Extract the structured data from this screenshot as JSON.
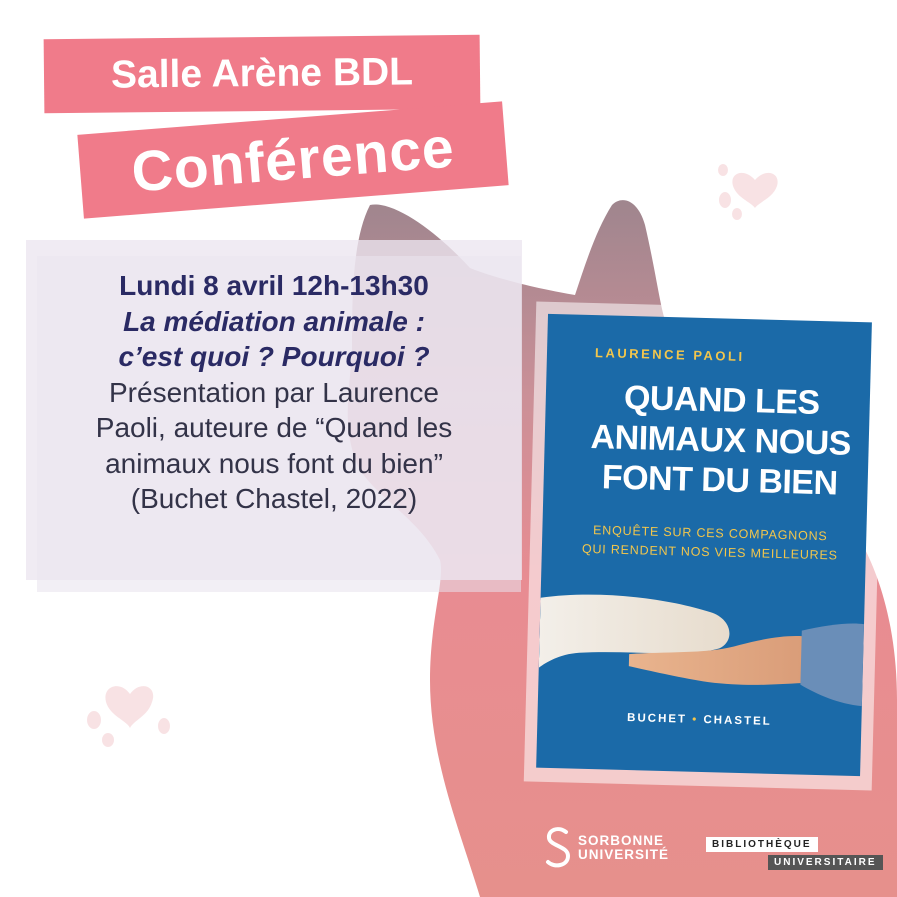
{
  "header": {
    "venue": "Salle Arène BDL",
    "event_type": "Conférence"
  },
  "event": {
    "date_time": "Lundi 8 avril 12h-13h30",
    "title_line1": "La médiation animale :",
    "title_line2": "c’est quoi ? Pourquoi ?",
    "desc_line1": "Présentation par Laurence",
    "desc_line2": "Paoli, auteure de “Quand les",
    "desc_line3": "animaux nous font du bien”",
    "desc_line4": "(Buchet Chastel, 2022)"
  },
  "book": {
    "author": "LAURENCE PAOLI",
    "title_line1": "QUAND LES",
    "title_line2": "ANIMAUX NOUS",
    "title_line3": "FONT DU BIEN",
    "subtitle_line1": "ENQUÊTE SUR CES COMPAGNONS",
    "subtitle_line2": "QUI RENDENT NOS VIES MEILLEURES",
    "publisher_left": "BUCHET",
    "publisher_right": "CHASTEL"
  },
  "logos": {
    "sorbonne_line1": "SORBONNE",
    "sorbonne_line2": "UNIVERSITÉ",
    "library_line1": "BIBLIOTHÈQUE",
    "library_line2": "UNIVERSITAIRE"
  },
  "colors": {
    "label_pink": "#f07b8a",
    "book_blue": "#1b6aa8",
    "book_yellow": "#f2c64c",
    "cat_red": "#e2787a",
    "text_navy": "#2a2a64"
  },
  "icons": [
    "cat-silhouette-icon",
    "paw-print-icon",
    "sorbonne-logo-icon"
  ]
}
